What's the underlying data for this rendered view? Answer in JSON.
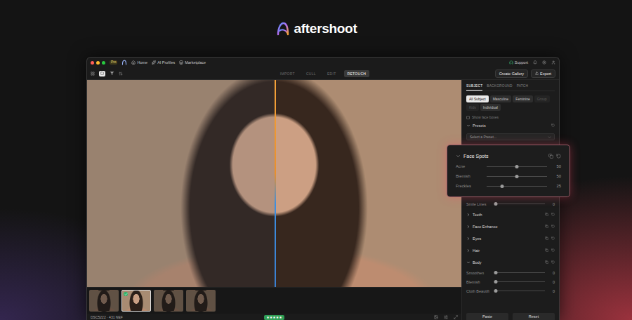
{
  "brand": {
    "name": "aftershoot"
  },
  "window": {
    "plan_badge": "Pro",
    "nav": [
      {
        "label": "Home"
      },
      {
        "label": "AI Profiles"
      },
      {
        "label": "Marketplace"
      }
    ],
    "support": "Support"
  },
  "toolbar": {
    "modes": [
      {
        "label": "IMPORT",
        "selected": false
      },
      {
        "label": "CULL",
        "selected": false
      },
      {
        "label": "EDIT",
        "selected": false
      },
      {
        "label": "RETOUCH",
        "selected": true
      }
    ],
    "create_gallery": "Create Gallery",
    "export": "Export"
  },
  "viewer": {
    "compare": {
      "level": 0.503
    }
  },
  "filmstrip": [
    {
      "selected": false,
      "checked": false
    },
    {
      "selected": true,
      "checked": true
    },
    {
      "selected": false,
      "checked": false
    },
    {
      "selected": false,
      "checked": false
    }
  ],
  "status_bar": {
    "filename": "DSC5222 · 431 NEF",
    "stars": 5,
    "star_glyph": "★"
  },
  "panel": {
    "tabs": [
      {
        "label": "SUBJECT",
        "selected": true
      },
      {
        "label": "BACKGROUND",
        "selected": false
      },
      {
        "label": "PATCH",
        "selected": false
      }
    ],
    "filters": [
      {
        "label": "All Subject",
        "selected": true,
        "disabled": false
      },
      {
        "label": "Masculine",
        "selected": false,
        "disabled": false
      },
      {
        "label": "Feminine",
        "selected": false,
        "disabled": false
      },
      {
        "label": "Group",
        "selected": false,
        "disabled": true
      },
      {
        "label": "Kids",
        "selected": false,
        "disabled": true
      },
      {
        "label": "Individual",
        "selected": false,
        "disabled": false
      }
    ],
    "show_face_boxes": {
      "label": "Show face boxes",
      "checked": false
    },
    "presets": {
      "title": "Presets",
      "expanded": true,
      "placeholder": "Select a Preset..."
    },
    "rows": [
      {
        "kind": "slider",
        "label": "Smile Lines",
        "level": 0,
        "value": "0"
      },
      {
        "kind": "section",
        "label": "Teeth",
        "expanded": false
      },
      {
        "kind": "section",
        "label": "Face Enhance",
        "expanded": false
      },
      {
        "kind": "section",
        "label": "Eyes",
        "expanded": false
      },
      {
        "kind": "section",
        "label": "Hair",
        "expanded": false
      },
      {
        "kind": "section",
        "label": "Body",
        "expanded": true
      },
      {
        "kind": "slider",
        "label": "Smoothen",
        "level": 0,
        "value": "0"
      },
      {
        "kind": "slider",
        "label": "Blemish",
        "level": 0,
        "value": "0"
      },
      {
        "kind": "slider",
        "label": "Cloth Beautifi",
        "level": 0,
        "value": "0"
      }
    ],
    "buttons": [
      "Paste",
      "Reset"
    ]
  },
  "face_spots": {
    "title": "Face Spots",
    "expanded": true,
    "sliders": [
      {
        "label": "Acne",
        "level": 0.5,
        "value": "50"
      },
      {
        "label": "Blemish",
        "level": 0.5,
        "value": "50"
      },
      {
        "label": "Freckles",
        "level": 0.25,
        "value": "25"
      }
    ]
  }
}
